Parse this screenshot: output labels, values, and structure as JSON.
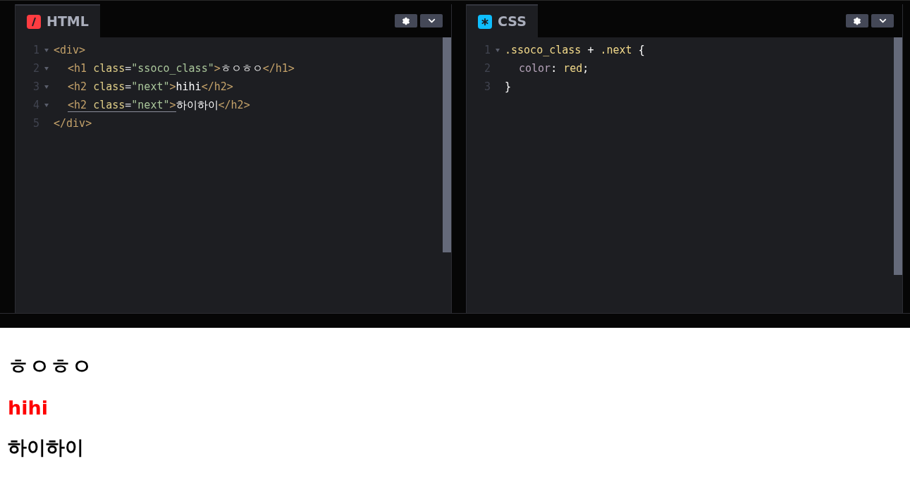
{
  "panels": [
    {
      "title": "HTML",
      "lines": [
        {
          "number": "1",
          "fold": true,
          "indented": false,
          "tokens": [
            {
              "kind": "tag",
              "text": "<div>"
            }
          ]
        },
        {
          "number": "2",
          "fold": true,
          "indented": true,
          "tokens": [
            {
              "kind": "tag",
              "text": "<h1 "
            },
            {
              "kind": "attr",
              "text": "class"
            },
            {
              "kind": "punct",
              "text": "="
            },
            {
              "kind": "string",
              "text": "\"ssoco_class\""
            },
            {
              "kind": "tag",
              "text": ">"
            },
            {
              "kind": "text",
              "text": "ㅎㅇㅎㅇ"
            },
            {
              "kind": "tag",
              "text": "</h1>"
            }
          ]
        },
        {
          "number": "3",
          "fold": true,
          "indented": true,
          "tokens": [
            {
              "kind": "tag",
              "text": "<h2 "
            },
            {
              "kind": "attr",
              "text": "class"
            },
            {
              "kind": "punct",
              "text": "="
            },
            {
              "kind": "string",
              "text": "\"next\""
            },
            {
              "kind": "tag",
              "text": ">"
            },
            {
              "kind": "text",
              "text": "hihi"
            },
            {
              "kind": "tag",
              "text": "</h2>"
            }
          ]
        },
        {
          "number": "4",
          "fold": true,
          "indented": true,
          "tokens": [
            {
              "kind": "tag",
              "text": "<h2 ",
              "matched": true
            },
            {
              "kind": "attr",
              "text": "class",
              "matched": true
            },
            {
              "kind": "punct",
              "text": "=",
              "matched": true
            },
            {
              "kind": "string",
              "text": "\"next\"",
              "matched": true
            },
            {
              "kind": "tag",
              "text": ">",
              "matched": true
            },
            {
              "kind": "text",
              "text": "하이하이"
            },
            {
              "kind": "tag",
              "text": "</h2>"
            }
          ]
        },
        {
          "number": "5",
          "fold": false,
          "indented": false,
          "tokens": [
            {
              "kind": "tag",
              "text": "</div>"
            }
          ]
        }
      ]
    },
    {
      "title": "CSS",
      "lines": [
        {
          "number": "1",
          "fold": true,
          "indented": false,
          "tokens": [
            {
              "kind": "selector",
              "text": ".ssoco_class "
            },
            {
              "kind": "text",
              "text": "+ "
            },
            {
              "kind": "selector",
              "text": ".next "
            },
            {
              "kind": "text",
              "text": "{"
            }
          ]
        },
        {
          "number": "2",
          "fold": false,
          "indented": true,
          "tokens": [
            {
              "kind": "property",
              "text": "color"
            },
            {
              "kind": "text",
              "text": ": "
            },
            {
              "kind": "value",
              "text": "red"
            },
            {
              "kind": "text",
              "text": ";"
            }
          ]
        },
        {
          "number": "3",
          "fold": false,
          "indented": false,
          "tokens": [
            {
              "kind": "text",
              "text": "}"
            }
          ]
        }
      ]
    }
  ],
  "preview": [
    {
      "kind": "h1",
      "text": "ㅎㅇㅎㅇ",
      "color": "#000000"
    },
    {
      "kind": "h2",
      "text": "hihi",
      "color": "#ff0000"
    },
    {
      "kind": "h2",
      "text": "하이하이",
      "color": "#000000"
    }
  ]
}
